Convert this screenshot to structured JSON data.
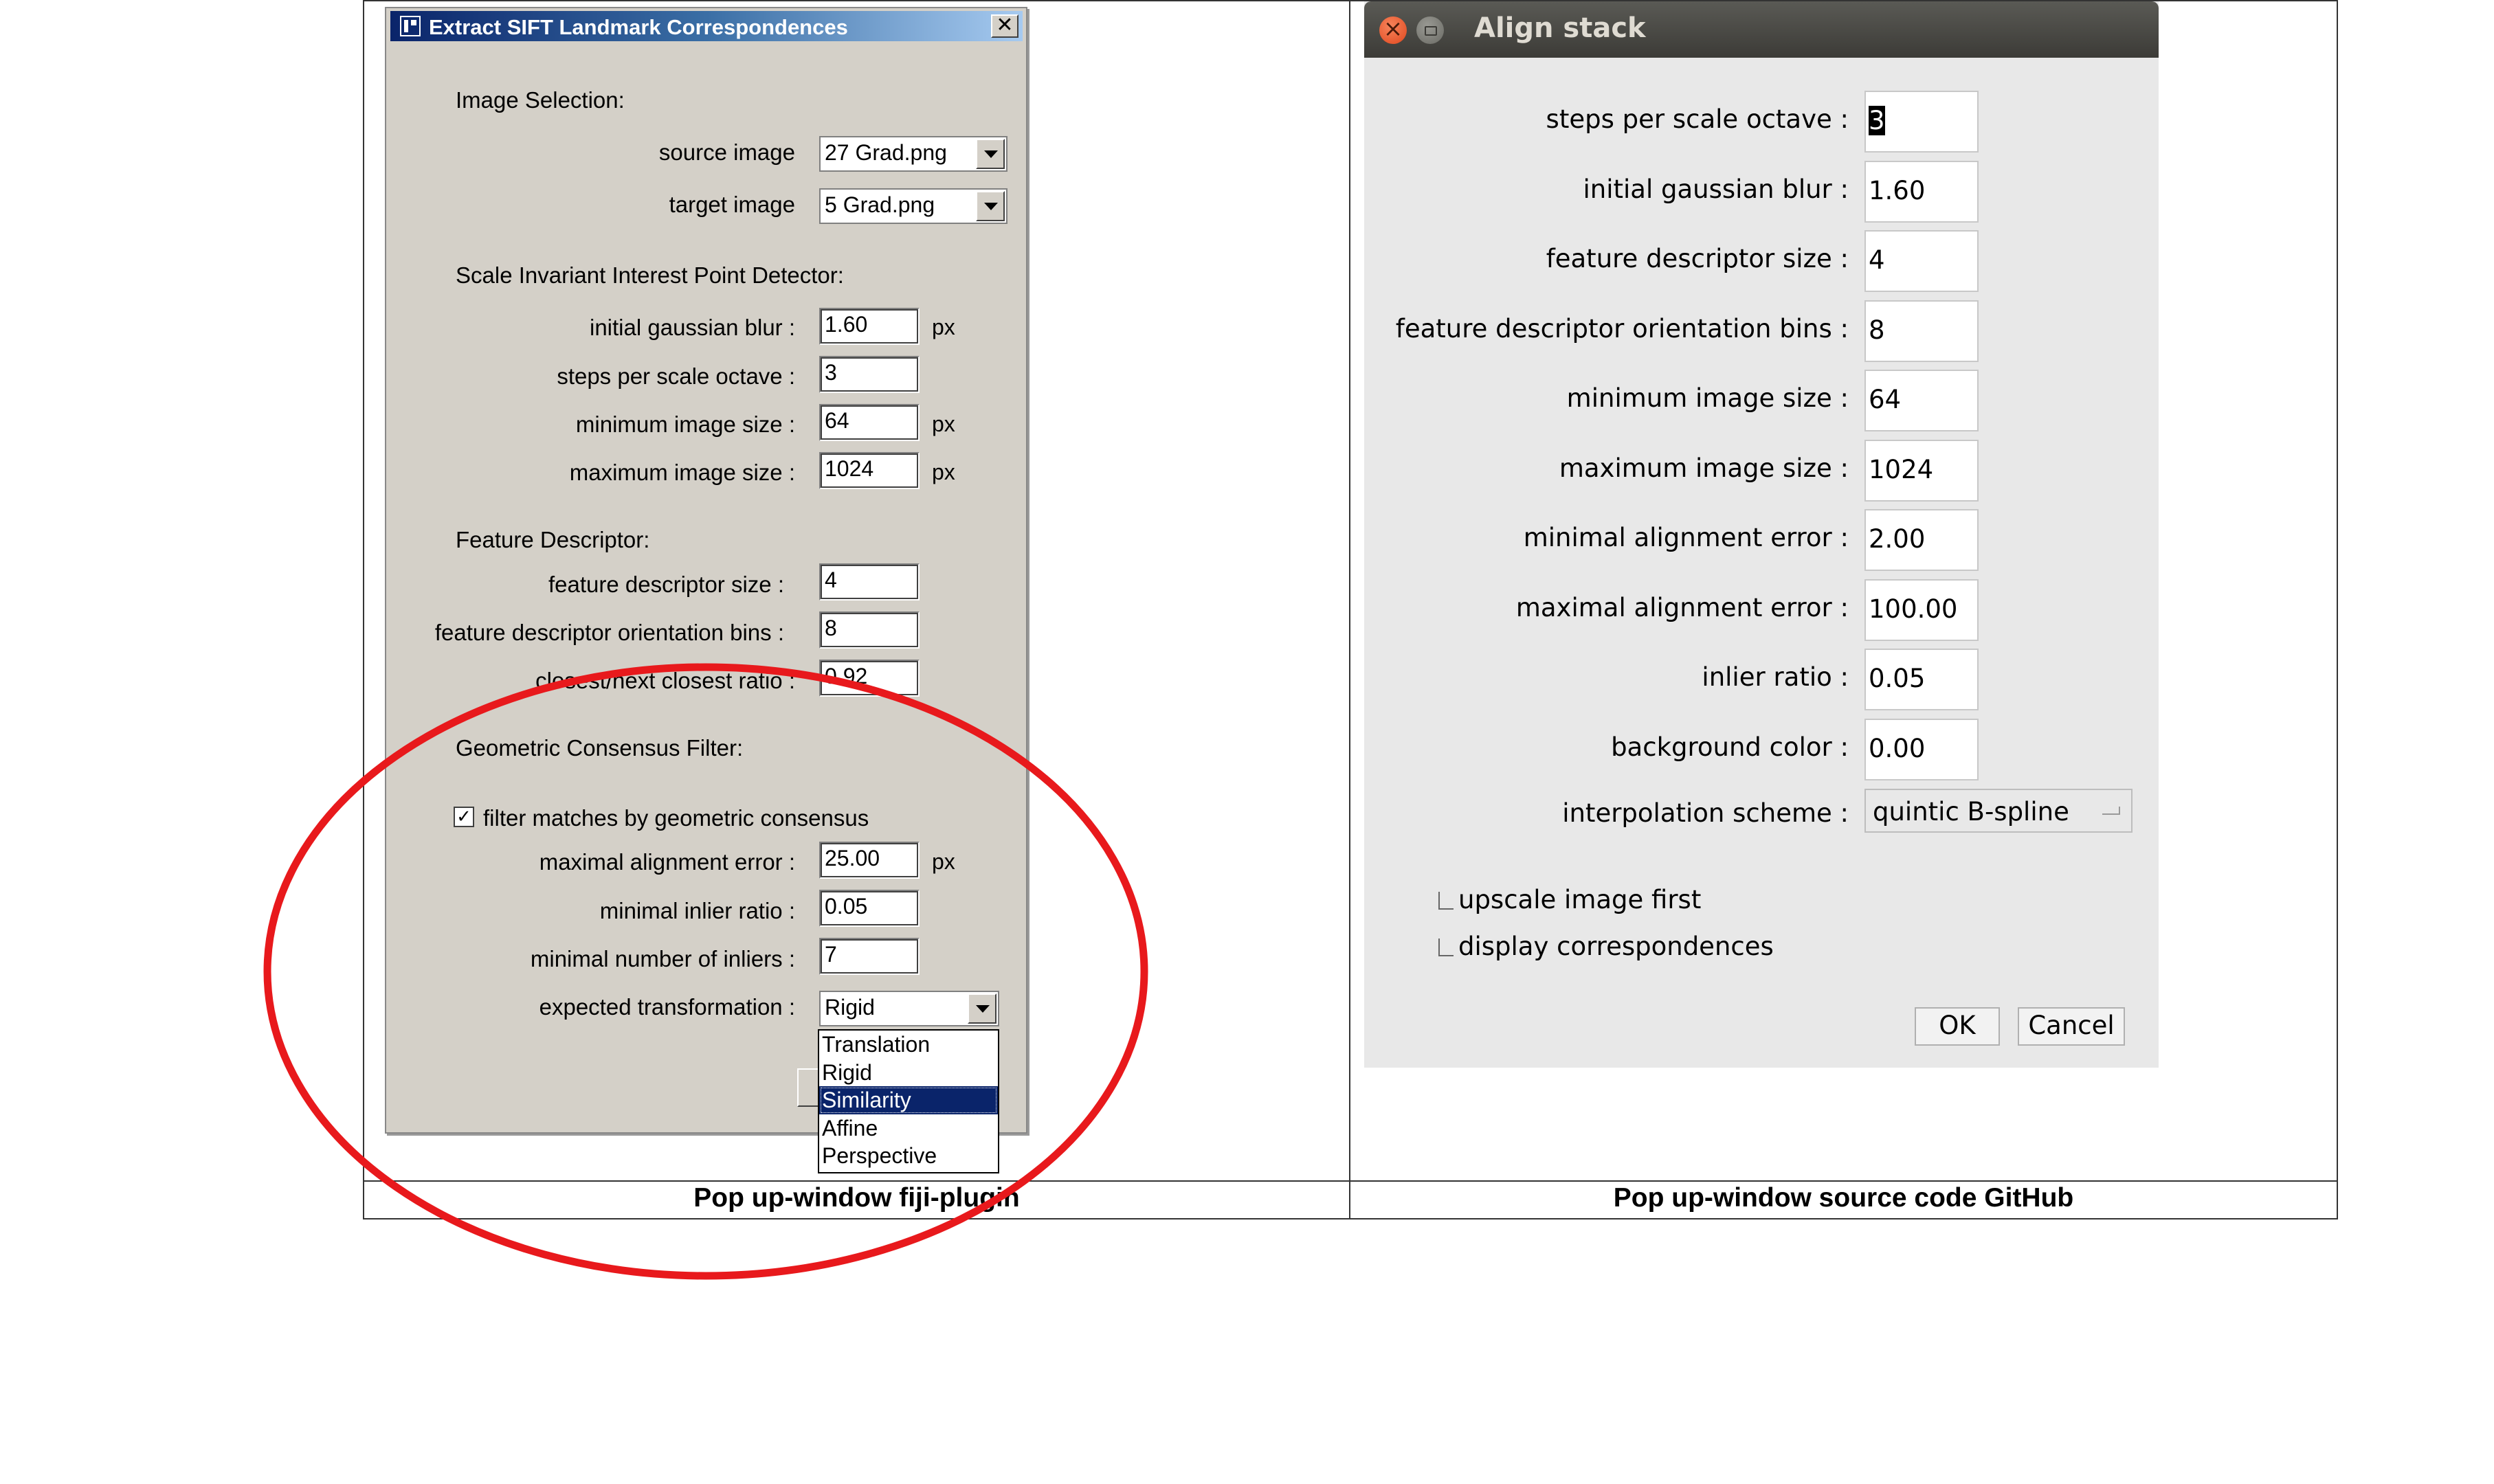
{
  "captions": {
    "left": "Pop up-window fiji-plugin",
    "right": "Pop up-window source code GitHub"
  },
  "fiji": {
    "title": "Extract SIFT Landmark Correspondences",
    "close_glyph": "✕",
    "sections": {
      "image_selection": "Image Selection:",
      "detector": "Scale Invariant Interest Point Detector:",
      "descriptor": "Feature Descriptor:",
      "consensus": "Geometric Consensus Filter:"
    },
    "source_image": {
      "label": "source image",
      "value": "27 Grad.png"
    },
    "target_image": {
      "label": "target image",
      "value": "5 Grad.png"
    },
    "fields": {
      "initial_blur": {
        "label": "initial gaussian blur :",
        "value": "1.60",
        "unit": "px"
      },
      "steps": {
        "label": "steps per scale octave :",
        "value": "3"
      },
      "min_size": {
        "label": "minimum image size :",
        "value": "64",
        "unit": "px"
      },
      "max_size": {
        "label": "maximum image size :",
        "value": "1024",
        "unit": "px"
      },
      "desc_size": {
        "label": "feature descriptor size :",
        "value": "4"
      },
      "orient_bins": {
        "label": "feature descriptor orientation bins :",
        "value": "8"
      },
      "ratio": {
        "label": "closest/next closest ratio :",
        "value": "0.92"
      },
      "max_err": {
        "label": "maximal alignment error :",
        "value": "25.00",
        "unit": "px"
      },
      "min_inlier_ratio": {
        "label": "minimal inlier ratio :",
        "value": "0.05"
      },
      "min_inliers": {
        "label": "minimal number of inliers :",
        "value": "7"
      }
    },
    "filter_checkbox": {
      "label": "filter matches by geometric consensus",
      "checked": true,
      "mark": "✓"
    },
    "transformation": {
      "label": "expected transformation :",
      "value": "Rigid",
      "options": [
        "Translation",
        "Rigid",
        "Similarity",
        "Affine",
        "Perspective"
      ],
      "highlighted": "Similarity"
    }
  },
  "align": {
    "title": "Align stack",
    "fields": [
      {
        "label": "steps per scale octave :",
        "value": "3"
      },
      {
        "label": "initial gaussian blur :",
        "value": "1.60"
      },
      {
        "label": "feature descriptor size :",
        "value": "4"
      },
      {
        "label": "feature descriptor orientation bins :",
        "value": "8"
      },
      {
        "label": "minimum image size :",
        "value": "64"
      },
      {
        "label": "maximum image size :",
        "value": "1024"
      },
      {
        "label": "minimal alignment error :",
        "value": "2.00"
      },
      {
        "label": "maximal alignment error :",
        "value": "100.00"
      },
      {
        "label": "inlier ratio :",
        "value": "0.05"
      },
      {
        "label": "background color :",
        "value": "0.00"
      }
    ],
    "interpolation": {
      "label": "interpolation scheme :",
      "value": "quintic B-spline"
    },
    "checkboxes": [
      {
        "label": "upscale image first",
        "checked": false
      },
      {
        "label": "display correspondences",
        "checked": false
      }
    ],
    "ok_label": "OK",
    "cancel_label": "Cancel"
  },
  "colors": {
    "annotation_ellipse": "#e8191c",
    "fiji_bg": "#d4d0c8",
    "selection": "#0a246a"
  }
}
